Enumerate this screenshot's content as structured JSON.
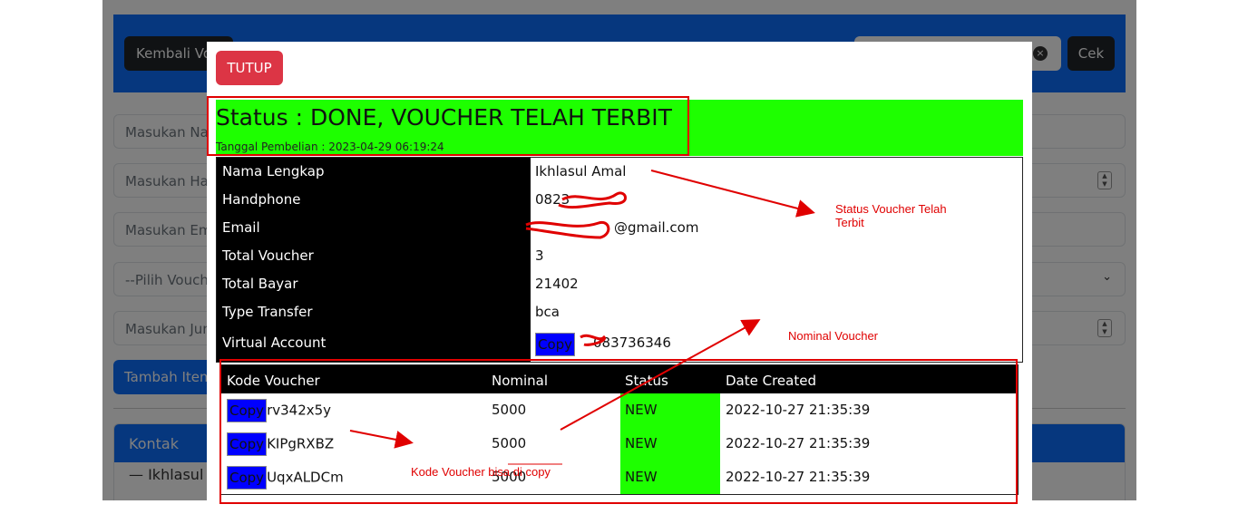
{
  "background_form": {
    "back_button": "Kembali Vo",
    "check_button": "Cek",
    "clear_icon": "×",
    "fields": [
      {
        "placeholder": "Masukan Na"
      },
      {
        "placeholder": "Masukan Ha"
      },
      {
        "placeholder": "Masukan Em"
      },
      {
        "placeholder": "--Pilih Vouch"
      },
      {
        "placeholder": "Masukan Jun"
      }
    ],
    "select_arrow": "⌄",
    "add_button": "Tambah Item",
    "contact_header": "Kontak",
    "contact_text": "— Ikhlasul"
  },
  "modal": {
    "close_button": "TUTUP",
    "status_title": "Status : DONE, VOUCHER TELAH TERBIT",
    "purchase_date": "Tanggal Pembelian : 2023-04-29 06:19:24",
    "info_rows": [
      {
        "label": "Nama Lengkap",
        "value": "Ikhlasul Amal"
      },
      {
        "label": "Handphone",
        "value": "0823"
      },
      {
        "label": "Email",
        "value": "@gmail.com"
      },
      {
        "label": "Total Voucher",
        "value": "3"
      },
      {
        "label": "Total Bayar",
        "value": "21402"
      },
      {
        "label": "Type Transfer",
        "value": "bca"
      },
      {
        "label": "Virtual Account",
        "value": "083736346",
        "copy_label": "Copy"
      }
    ],
    "voucher_table": {
      "headers": [
        "Kode Voucher",
        "Nominal",
        "Status",
        "Date Created"
      ],
      "rows": [
        {
          "copy_label": "Copy",
          "code": "rv342x5y",
          "nominal": "5000",
          "status": "NEW",
          "date": "2022-10-27 21:35:39"
        },
        {
          "copy_label": "Copy",
          "code": "KIPgRXBZ",
          "nominal": "5000",
          "status": "NEW",
          "date": "2022-10-27 21:35:39"
        },
        {
          "copy_label": "Copy",
          "code": "UqxALDCm",
          "nominal": "5000",
          "status": "NEW",
          "date": "2022-10-27 21:35:39"
        }
      ]
    }
  },
  "annotations": {
    "status_note_line1": "Status Voucher Telah",
    "status_note_line2": "Terbit",
    "nominal_note": "Nominal Voucher",
    "copy_note": "Kode Voucher bisa di copy",
    "color": "#e00000"
  },
  "colors": {
    "status_green": "#1eff00",
    "copy_blue": "#0000ff",
    "close_red": "#dc3545",
    "primary_blue": "#0d6efd"
  }
}
